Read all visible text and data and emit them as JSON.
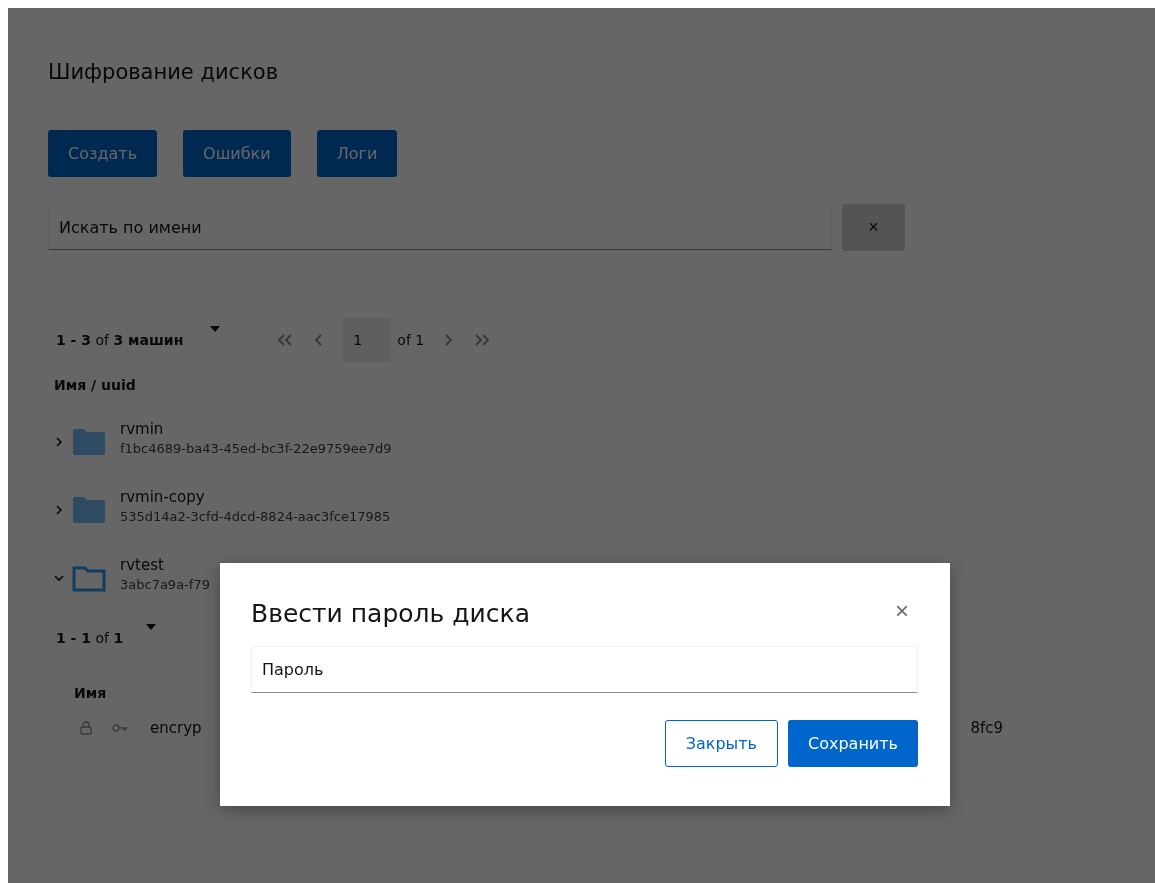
{
  "page": {
    "title": "Шифрование дисков",
    "buttons": [
      "Создать",
      "Ошибки",
      "Логи"
    ],
    "search": {
      "placeholder": "Искать по имени",
      "clear": "×"
    },
    "pager": {
      "summary": "**1 - 3** of **3 машин**",
      "page": "1",
      "of": "of 1"
    },
    "tree": {
      "column": "Имя / uuid",
      "items": [
        {
          "name": "rvmin",
          "uuid": "f1bc4689-ba43-45ed-bc3f-22e9759ee7d9",
          "expanded": false
        },
        {
          "name": "rvmin-copy",
          "uuid": "535d14a2-3cfd-4dcd-8824-aac3fce17985",
          "expanded": false
        },
        {
          "name": "rvtest",
          "uuid": "3abc7a9a-f79",
          "expanded": true,
          "disks": {
            "pager": "**1 - 1** of **1**",
            "column": "Имя",
            "rows": [
              {
                "name": "encryp",
                "column_2": "8fc9"
              }
            ]
          }
        }
      ]
    }
  },
  "dialog": {
    "title": "Ввести пароль диска",
    "close": "×",
    "password": {
      "placeholder": "Пароль"
    },
    "buttons": [
      {
        "label": "Закрыть",
        "kind": "secondary"
      },
      {
        "label": "Сохранить",
        "kind": "primary"
      }
    ]
  }
}
